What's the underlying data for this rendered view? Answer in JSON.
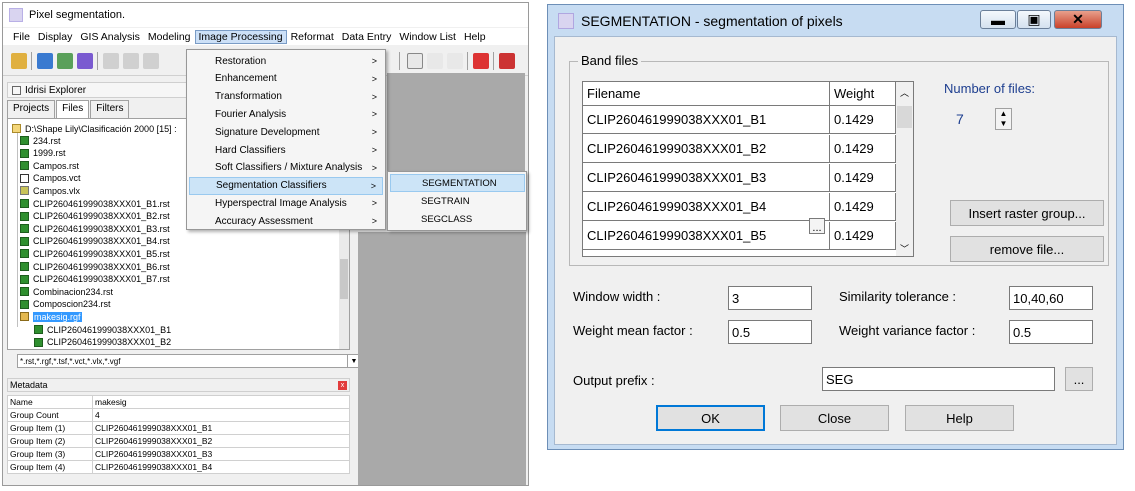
{
  "left_window": {
    "title": "Pixel segmentation.",
    "menu": [
      "File",
      "Display",
      "GIS Analysis",
      "Modeling",
      "Image Processing",
      "Reformat",
      "Data Entry",
      "Window List",
      "Help"
    ],
    "explorer_title": "Idrisi Explorer",
    "tabs": [
      "Projects",
      "Files",
      "Filters"
    ],
    "tree": {
      "root": "D:\\Shape Lily\\Clasificación 2000 [15] :",
      "items": [
        {
          "label": "234.rst",
          "type": "rst"
        },
        {
          "label": "1999.rst",
          "type": "rst"
        },
        {
          "label": "Campos.rst",
          "type": "rst"
        },
        {
          "label": "Campos.vct",
          "type": "vct"
        },
        {
          "label": "Campos.vlx",
          "type": "vlx"
        },
        {
          "label": "CLIP260461999038XXX01_B1.rst",
          "type": "rst"
        },
        {
          "label": "CLIP260461999038XXX01_B2.rst",
          "type": "rst"
        },
        {
          "label": "CLIP260461999038XXX01_B3.rst",
          "type": "rst"
        },
        {
          "label": "CLIP260461999038XXX01_B4.rst",
          "type": "rst"
        },
        {
          "label": "CLIP260461999038XXX01_B5.rst",
          "type": "rst"
        },
        {
          "label": "CLIP260461999038XXX01_B6.rst",
          "type": "rst"
        },
        {
          "label": "CLIP260461999038XXX01_B7.rst",
          "type": "rst"
        },
        {
          "label": "Combinacion234.rst",
          "type": "rst"
        },
        {
          "label": "Composcion234.rst",
          "type": "rst"
        },
        {
          "label": "makesig.rgf",
          "type": "rgf"
        },
        {
          "label": "CLIP260461999038XXX01_B1",
          "type": "rst"
        },
        {
          "label": "CLIP260461999038XXX01_B2",
          "type": "rst"
        }
      ]
    },
    "filter": "*.rst,*.rgf,*.tsf,*.vct,*.vlx,*.vgf",
    "metadata": {
      "title": "Metadata",
      "rows": [
        [
          "Name",
          "makesig"
        ],
        [
          "Group Count",
          "4"
        ],
        [
          "Group Item (1)",
          "CLIP260461999038XXX01_B1"
        ],
        [
          "Group Item (2)",
          "CLIP260461999038XXX01_B2"
        ],
        [
          "Group Item (3)",
          "CLIP260461999038XXX01_B3"
        ],
        [
          "Group Item (4)",
          "CLIP260461999038XXX01_B4"
        ]
      ]
    },
    "image_processing_menu": [
      "Restoration",
      "Enhancement",
      "Transformation",
      "Fourier Analysis",
      "Signature Development",
      "Hard Classifiers",
      "Soft Classifiers / Mixture Analysis",
      "Segmentation Classifiers",
      "Hyperspectral Image Analysis",
      "Accuracy Assessment"
    ],
    "submenu_arrow": ">",
    "segmentation_submenu": [
      "SEGMENTATION",
      "SEGTRAIN",
      "SEGCLASS"
    ]
  },
  "dialog": {
    "title": "SEGMENTATION - segmentation of pixels",
    "band_files_label": "Band files",
    "grid_headers": [
      "Filename",
      "Weight"
    ],
    "grid_rows": [
      [
        "CLIP260461999038XXX01_B1",
        "0.1429"
      ],
      [
        "CLIP260461999038XXX01_B2",
        "0.1429"
      ],
      [
        "CLIP260461999038XXX01_B3",
        "0.1429"
      ],
      [
        "CLIP260461999038XXX01_B4",
        "0.1429"
      ],
      [
        "CLIP260461999038XXX01_B5",
        "0.1429"
      ]
    ],
    "number_of_files_label": "Number of files:",
    "number_of_files": "7",
    "insert_raster_group": "Insert raster group...",
    "remove_file": "remove file...",
    "window_width_label": "Window width :",
    "window_width": "3",
    "similarity_tolerance_label": "Similarity tolerance :",
    "similarity_tolerance": "10,40,60",
    "weight_mean_label": "Weight mean factor :",
    "weight_mean": "0.5",
    "weight_variance_label": "Weight variance factor :",
    "weight_variance": "0.5",
    "output_prefix_label": "Output prefix :",
    "output_prefix": "SEG",
    "ellipsis": "...",
    "ok": "OK",
    "close": "Close",
    "help": "Help"
  }
}
